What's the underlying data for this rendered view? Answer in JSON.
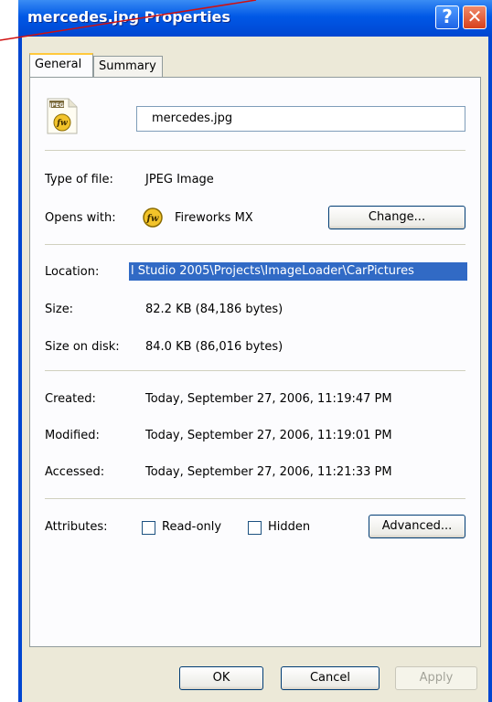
{
  "window": {
    "title": "mercedes.jpg Properties",
    "help_glyph": "?",
    "close_glyph": "✕"
  },
  "tabs": [
    {
      "label": "General",
      "active": true
    },
    {
      "label": "Summary",
      "active": false
    }
  ],
  "general": {
    "file_icon_badge": "JPEG",
    "file_icon_app": "fw",
    "filename": "mercedes.jpg",
    "type_label": "Type of file:",
    "type_value": "JPEG Image",
    "opens_label": "Opens with:",
    "opens_app_icon": "fw",
    "opens_value": "Fireworks MX",
    "change_button": "Change...",
    "location_label": "Location:",
    "location_value": "l Studio 2005\\Projects\\ImageLoader\\CarPictures",
    "size_label": "Size:",
    "size_value": "82.2 KB (84,186 bytes)",
    "size_disk_label": "Size on disk:",
    "size_disk_value": "84.0 KB (86,016 bytes)",
    "created_label": "Created:",
    "created_value": "Today, September 27, 2006, 11:19:47 PM",
    "modified_label": "Modified:",
    "modified_value": "Today, September 27, 2006, 11:19:01 PM",
    "accessed_label": "Accessed:",
    "accessed_value": "Today, September 27, 2006, 11:21:33 PM",
    "attributes_label": "Attributes:",
    "readonly_label": "Read-only",
    "readonly_checked": false,
    "hidden_label": "Hidden",
    "hidden_checked": false,
    "advanced_button": "Advanced..."
  },
  "footer": {
    "ok_button": "OK",
    "cancel_button": "Cancel",
    "apply_button": "Apply",
    "apply_enabled": false
  },
  "colors": {
    "titlebar": "#0058e6",
    "dialog_bg": "#ECE9D8",
    "selection": "#316ac5",
    "annotation_line": "#d01010"
  }
}
